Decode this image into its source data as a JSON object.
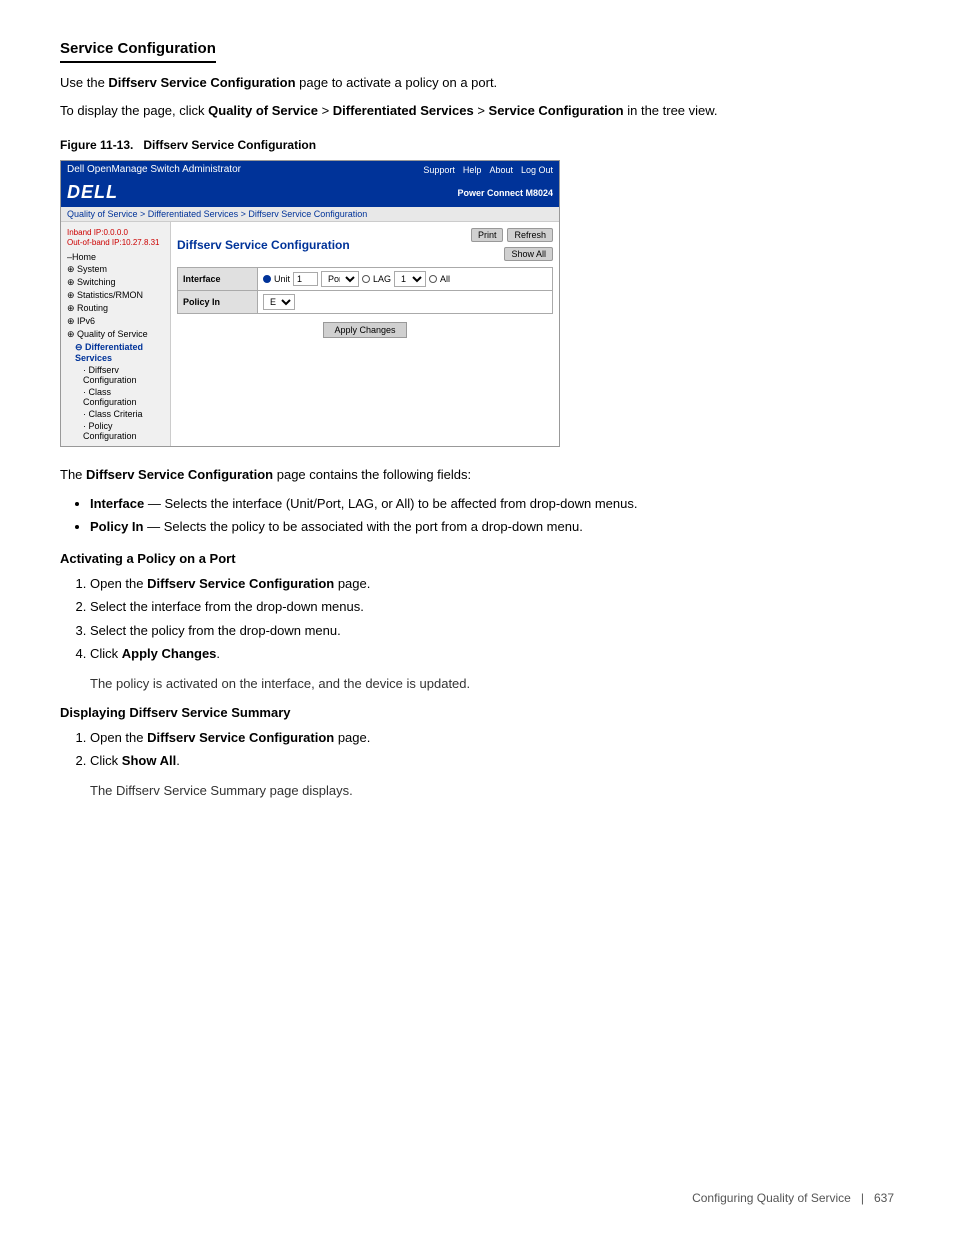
{
  "page": {
    "section_title": "Service Configuration",
    "intro1": "Use the ",
    "intro1_bold": "Diffserv Service Configuration",
    "intro1_rest": " page to activate a policy on a port.",
    "intro2_pre": "To display the page, click ",
    "intro2_bold1": "Quality of Service",
    "intro2_sep1": " > ",
    "intro2_bold2": "Differentiated Services",
    "intro2_sep2": " > ",
    "intro2_bold3": "Service Configuration",
    "intro2_post": " in the tree view.",
    "figure_label": "Figure 11-13.",
    "figure_title": "Diffserv Service Configuration"
  },
  "screenshot": {
    "header_title": "Dell OpenManage Switch Administrator",
    "header_links": [
      "Support",
      "Help",
      "About",
      "Log Out"
    ],
    "product_name": "Power Connect M8024",
    "logo": "DELL",
    "inband_ip": "Inband IP:0.0.0.0",
    "outband_ip": "Out-of-band IP:10.27.8.31",
    "breadcrumb": "Quality of Service > Differentiated Services > Diffserv Service Configuration",
    "page_title": "Diffserv Service Configuration",
    "btn_print": "Print",
    "btn_refresh": "Refresh",
    "btn_show_all": "Show All",
    "sidebar_items": [
      {
        "label": "Home",
        "level": 0
      },
      {
        "label": "System",
        "level": 0,
        "has_expand": true
      },
      {
        "label": "Switching",
        "level": 0,
        "has_expand": true
      },
      {
        "label": "Statistics/RMON",
        "level": 0,
        "has_expand": true
      },
      {
        "label": "Routing",
        "level": 0,
        "has_expand": true
      },
      {
        "label": "IPv6",
        "level": 0,
        "has_expand": true
      },
      {
        "label": "Quality of Service",
        "level": 0,
        "has_expand": true
      },
      {
        "label": "Differentiated Services",
        "level": 1,
        "has_expand": true
      },
      {
        "label": "Diffserv Configuration",
        "level": 2
      },
      {
        "label": "Class Configuration",
        "level": 2
      },
      {
        "label": "Class Criteria",
        "level": 2
      },
      {
        "label": "Policy Configuration",
        "level": 2
      }
    ],
    "field_interface_label": "Interface",
    "field_policy_label": "Policy In",
    "policy_value": "East",
    "btn_apply": "Apply Changes"
  },
  "fields_description": {
    "intro": "The ",
    "intro_bold": "Diffserv Service Configuration",
    "intro_rest": " page contains the following fields:",
    "bullets": [
      {
        "term": "Interface",
        "em_dash": " — ",
        "desc": "Selects the interface (Unit/Port, LAG, or All) to be affected from drop-down menus."
      },
      {
        "term": "Policy In",
        "em_dash": " — ",
        "desc": "Selects the policy to be associated with the port from a drop-down menu."
      }
    ]
  },
  "section_activate": {
    "title": "Activating a Policy on a Port",
    "steps": [
      {
        "text": "Open the ",
        "bold": "Diffserv Service Configuration",
        "rest": " page."
      },
      {
        "text": "Select the interface from the drop-down menus.",
        "bold": "",
        "rest": ""
      },
      {
        "text": "Select the policy from the drop-down menu.",
        "bold": "",
        "rest": ""
      },
      {
        "text": "Click ",
        "bold": "Apply Changes",
        "rest": "."
      },
      {
        "indent": "The policy is activated on the interface, and the device is updated."
      }
    ]
  },
  "section_display": {
    "title": "Displaying Diffserv Service Summary",
    "steps": [
      {
        "text": "Open the ",
        "bold": "Diffserv Service Configuration",
        "rest": " page."
      },
      {
        "text": "Click ",
        "bold": "Show All",
        "rest": "."
      },
      {
        "indent": "The Diffserv Service Summary page displays."
      }
    ]
  },
  "footer": {
    "left": "Configuring Quality of Service",
    "separator": "|",
    "page_number": "637"
  }
}
